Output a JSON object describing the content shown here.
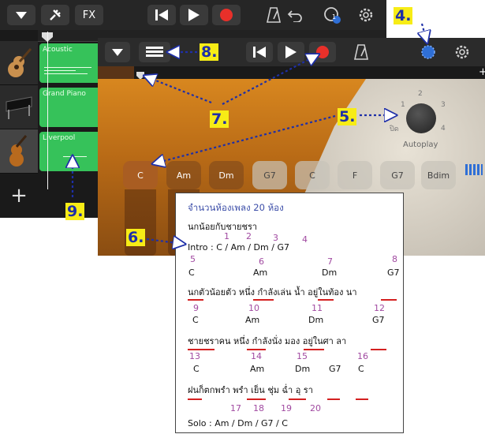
{
  "back_window": {
    "toolbar": {
      "fx_label": "FX",
      "notification_count": "1"
    },
    "tracks": [
      {
        "name": "Acoustic",
        "instrument_icon": "acoustic-guitar-icon"
      },
      {
        "name": "Grand Piano",
        "instrument_icon": "piano-icon"
      },
      {
        "name": "Liverpool",
        "instrument_icon": "violin-bass-icon"
      }
    ],
    "add_track_label": "+"
  },
  "front_window": {
    "chords": [
      "C",
      "Am",
      "Dm",
      "G7",
      "C",
      "F",
      "G7",
      "Bdim"
    ],
    "selected_chord": "C",
    "autoplay": {
      "label": "Autoplay",
      "off_label": "ปิด",
      "positions": [
        "1",
        "2",
        "3",
        "4"
      ]
    }
  },
  "lyrics_panel": {
    "title": "จำนวนห้องเพลง 20 ห้อง",
    "song_name": "นกน้อยกับชายชรา",
    "intro": {
      "label": "Intro : C / Am / Dm / G7",
      "numbers": [
        "1",
        "2",
        "3",
        "4"
      ]
    },
    "rows": [
      {
        "numbers": [
          "5",
          "6",
          "7",
          "8"
        ],
        "chords": [
          "C",
          "Am",
          "Dm",
          "G7"
        ],
        "lyric": "นกตัวน้อยตัว หนึ่ง กำลังเล่น น้ำ อยู่ในท้อง นา"
      },
      {
        "numbers": [
          "9",
          "10",
          "11",
          "12"
        ],
        "chords": [
          "C",
          "Am",
          "Dm",
          "G7"
        ],
        "lyric": "ชายชราคน หนึ่ง กำลังนั่ง มอง อยู่ในศา ลา"
      },
      {
        "numbers": [
          "13",
          "14",
          "15",
          "16"
        ],
        "chords": [
          "C",
          "Am",
          "Dm",
          "G7",
          "C"
        ],
        "lyric": "ฝนก็ตกพรำ พรำ เย็น ชุ่ม ฉ่ำ อุ รา"
      }
    ],
    "solo": {
      "label": "Solo :  Am / Dm / G7 / C",
      "numbers": [
        "17",
        "18",
        "19",
        "20"
      ]
    }
  },
  "callouts": [
    "4.",
    "5.",
    "6.",
    "7.",
    "8.",
    "9."
  ],
  "colors": {
    "record": "#e8302a",
    "region_green": "#36c25a",
    "callout_bg": "#f7ec16",
    "callout_text": "#1e2fa8",
    "bar_number": "#a14aa1",
    "underline": "#d42020"
  }
}
